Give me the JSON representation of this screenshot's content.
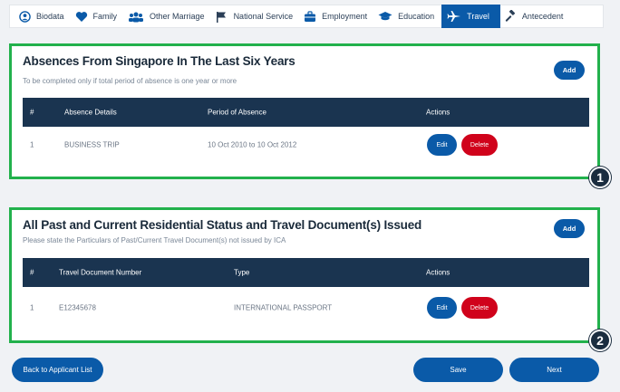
{
  "tabs": [
    {
      "label": "Biodata",
      "icon": "user-icon"
    },
    {
      "label": "Family",
      "icon": "heart-icon"
    },
    {
      "label": "Other Marriage",
      "icon": "people-icon"
    },
    {
      "label": "National Service",
      "icon": "flag-icon"
    },
    {
      "label": "Employment",
      "icon": "briefcase-icon"
    },
    {
      "label": "Education",
      "icon": "graduation-cap-icon"
    },
    {
      "label": "Travel",
      "icon": "airplane-icon",
      "active": true
    },
    {
      "label": "Antecedent",
      "icon": "gavel-icon"
    }
  ],
  "absences": {
    "title": "Absences From Singapore In The Last Six Years",
    "subtitle": "To be completed only if total period of absence is one year or more",
    "add_label": "Add",
    "columns": [
      "#",
      "Absence Details",
      "Period of Absence",
      "Actions"
    ],
    "rows": [
      {
        "num": "1",
        "details": "BUSINESS TRIP",
        "period": "10 Oct 2010 to 10 Oct 2012"
      }
    ],
    "edit_label": "Edit",
    "delete_label": "Delete",
    "badge": "1"
  },
  "residential": {
    "title": "All Past and Current Residential Status and Travel Document(s) Issued",
    "subtitle": "Please state the Particulars of Past/Current Travel Document(s) not issued by ICA",
    "add_label": "Add",
    "columns": [
      "#",
      "Travel Document Number",
      "Type",
      "Actions"
    ],
    "rows": [
      {
        "num": "1",
        "doc_number": "E12345678",
        "type": "INTERNATIONAL PASSPORT"
      }
    ],
    "edit_label": "Edit",
    "delete_label": "Delete",
    "badge": "2"
  },
  "footer": {
    "back_label": "Back to Applicant List",
    "save_label": "Save",
    "next_label": "Next"
  },
  "colors": {
    "primary": "#0a5aa8",
    "danger": "#d0021b",
    "table_header": "#1a3450",
    "highlight": "#22b14c"
  }
}
